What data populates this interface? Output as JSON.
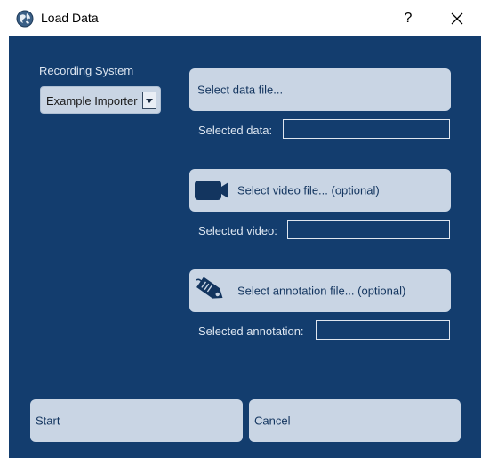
{
  "window": {
    "title": "Load Data",
    "help_label": "?",
    "icons": {
      "app": "globe-icon",
      "close": "close-icon"
    }
  },
  "recording": {
    "label": "Recording System",
    "selected": "Example Importer"
  },
  "data": {
    "button_label": "Select data file...",
    "selected_label": "Selected data:",
    "selected_value": ""
  },
  "video": {
    "button_label": "Select video file... (optional)",
    "selected_label": "Selected video:",
    "selected_value": "",
    "icon": "video-camera-icon"
  },
  "annotation": {
    "button_label": "Select annotation file... (optional)",
    "selected_label": "Selected annotation:",
    "selected_value": "",
    "icon": "tag-icon"
  },
  "footer": {
    "start_label": "Start",
    "cancel_label": "Cancel"
  },
  "colors": {
    "panel": "#133d6e",
    "button": "#c9d5e4",
    "button_text": "#13355f",
    "label_text": "#dde6f1"
  }
}
